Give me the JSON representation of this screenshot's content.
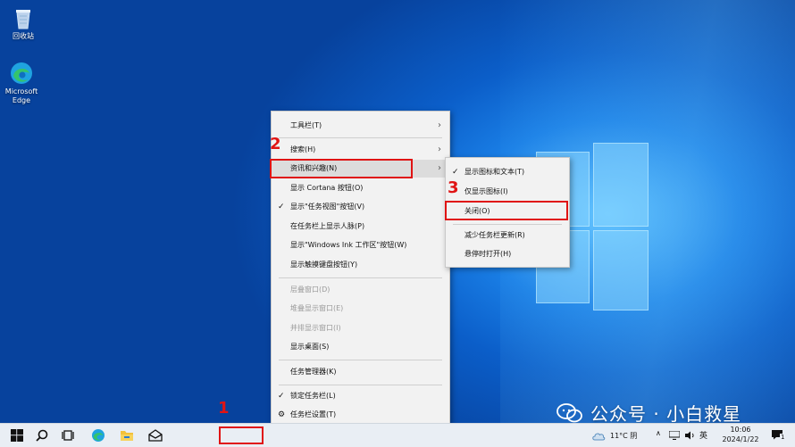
{
  "desktop": {
    "icons": [
      {
        "label": "回收站",
        "icon": "recycle-bin-icon"
      },
      {
        "label": "Microsoft Edge",
        "icon": "edge-icon"
      }
    ]
  },
  "context_menu": {
    "items": [
      {
        "label": "工具栏(T)",
        "submenu": true
      },
      {
        "label": "搜索(H)",
        "submenu": true
      },
      {
        "label": "资讯和兴趣(N)",
        "submenu": true
      },
      {
        "label": "显示 Cortana 按钮(O)"
      },
      {
        "label": "显示\"任务视图\"按钮(V)",
        "checked": true
      },
      {
        "label": "在任务栏上显示人脉(P)"
      },
      {
        "label": "显示\"Windows Ink 工作区\"按钮(W)"
      },
      {
        "label": "显示触摸键盘按钮(Y)"
      },
      {
        "label": "层叠窗口(D)",
        "disabled": true
      },
      {
        "label": "堆叠显示窗口(E)",
        "disabled": true
      },
      {
        "label": "并排显示窗口(I)",
        "disabled": true
      },
      {
        "label": "显示桌面(S)"
      },
      {
        "label": "任务管理器(K)"
      },
      {
        "label": "锁定任务栏(L)",
        "checked": true
      },
      {
        "label": "任务栏设置(T)",
        "icon": "gear-icon"
      }
    ]
  },
  "submenu": {
    "items": [
      {
        "label": "显示图标和文本(T)",
        "checked": true
      },
      {
        "label": "仅显示图标(I)"
      },
      {
        "label": "关闭(O)"
      },
      {
        "label": "减少任务栏更新(R)"
      },
      {
        "label": "悬停时打开(H)"
      }
    ]
  },
  "annotations": {
    "step1": "1",
    "step2": "2",
    "step3": "3",
    "color": "#e01414"
  },
  "taskbar": {
    "weather": "11°C 阴",
    "ime": "英",
    "time": "10:06",
    "date": "2024/1/22",
    "notification_count": "1"
  },
  "watermark": {
    "text": "公众号 · 小白救星"
  }
}
